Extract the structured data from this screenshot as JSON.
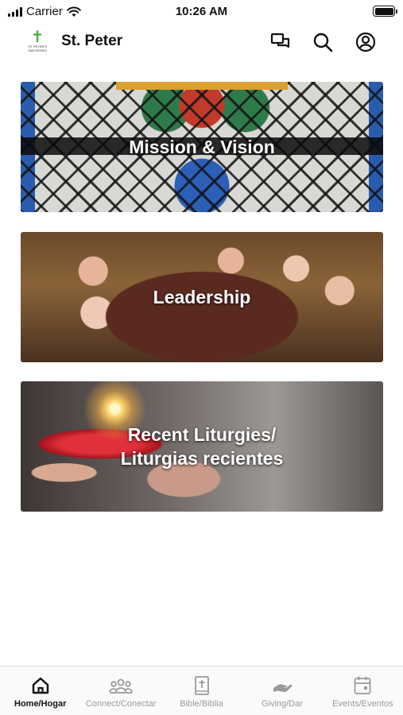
{
  "status_bar": {
    "carrier": "Carrier",
    "time": "10:26 AM"
  },
  "header": {
    "logo_text_line1": "ST. PETER'S",
    "logo_text_line2": "SAN PEDRO",
    "title": "St. Peter",
    "icons": [
      "chat-icon",
      "search-icon",
      "account-icon"
    ]
  },
  "cards": [
    {
      "label": "Mission & Vision"
    },
    {
      "label": "Leadership"
    },
    {
      "label_line1": "Recent Liturgies/",
      "label_line2": "Liturgias recientes"
    }
  ],
  "tabs": [
    {
      "label": "Home/Hogar",
      "icon": "home-icon",
      "active": true
    },
    {
      "label": "Connect/Conectar",
      "icon": "people-icon",
      "active": false
    },
    {
      "label": "Bible/Biblia",
      "icon": "bible-icon",
      "active": false
    },
    {
      "label": "Giving/Dar",
      "icon": "giving-icon",
      "active": false
    },
    {
      "label": "Events/Eventos",
      "icon": "calendar-icon",
      "active": false
    }
  ],
  "colors": {
    "accent": "#111111",
    "inactive": "#9a9a9a",
    "logo_cross": "#4caf3c"
  }
}
